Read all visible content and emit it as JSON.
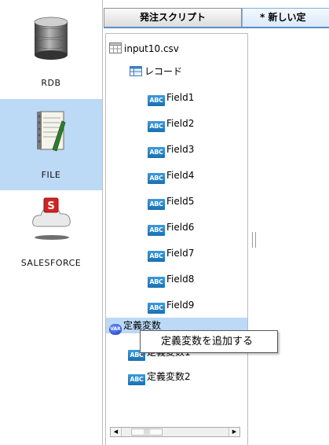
{
  "categories": [
    {
      "label": "RDB",
      "icon": "database-icon",
      "selected": false
    },
    {
      "label": "FILE",
      "icon": "notebook-file-icon",
      "selected": true
    },
    {
      "label": "SALESFORCE",
      "icon": "salesforce-cloud-icon",
      "selected": false
    }
  ],
  "tabs": [
    {
      "label": "発注スクリプト",
      "active": false
    },
    {
      "label": "* 新しい定",
      "active": true
    }
  ],
  "tree": {
    "file_label": "input10.csv",
    "record_label": "レコード",
    "type_badge": "ABC",
    "fields": [
      "Field1",
      "Field2",
      "Field3",
      "Field4",
      "Field5",
      "Field6",
      "Field7",
      "Field8",
      "Field9"
    ],
    "var_group_label": "定義変数",
    "var_badge": "VAR",
    "variables": [
      "定義変数1",
      "定義変数2"
    ]
  },
  "context_menu": {
    "items": [
      "定義変数を追加する"
    ]
  },
  "colors": {
    "selection": "#bcd9f6",
    "tab_accent": "#5b8fc7",
    "badge": "#1a6fb1"
  }
}
